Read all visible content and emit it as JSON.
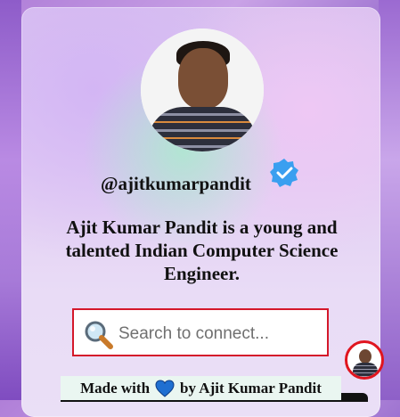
{
  "profile": {
    "handle": "@ajitkumarpandit",
    "bio": "Ajit Kumar Pandit is a young and talented Indian Computer Science Engineer.",
    "verified": true
  },
  "search": {
    "placeholder": "Search to connect...",
    "value": ""
  },
  "footer": {
    "prefix": "Made with",
    "heart_icon": "heart-icon",
    "suffix": "by Ajit Kumar Pandit"
  },
  "icons": {
    "verified": "verified-badge-icon",
    "search": "magnifier-icon"
  },
  "colors": {
    "search_border": "#d4182a",
    "verified_badge": "#3a9ff0",
    "fab_ring": "#e0151f",
    "heart": "#1f6fd1"
  }
}
